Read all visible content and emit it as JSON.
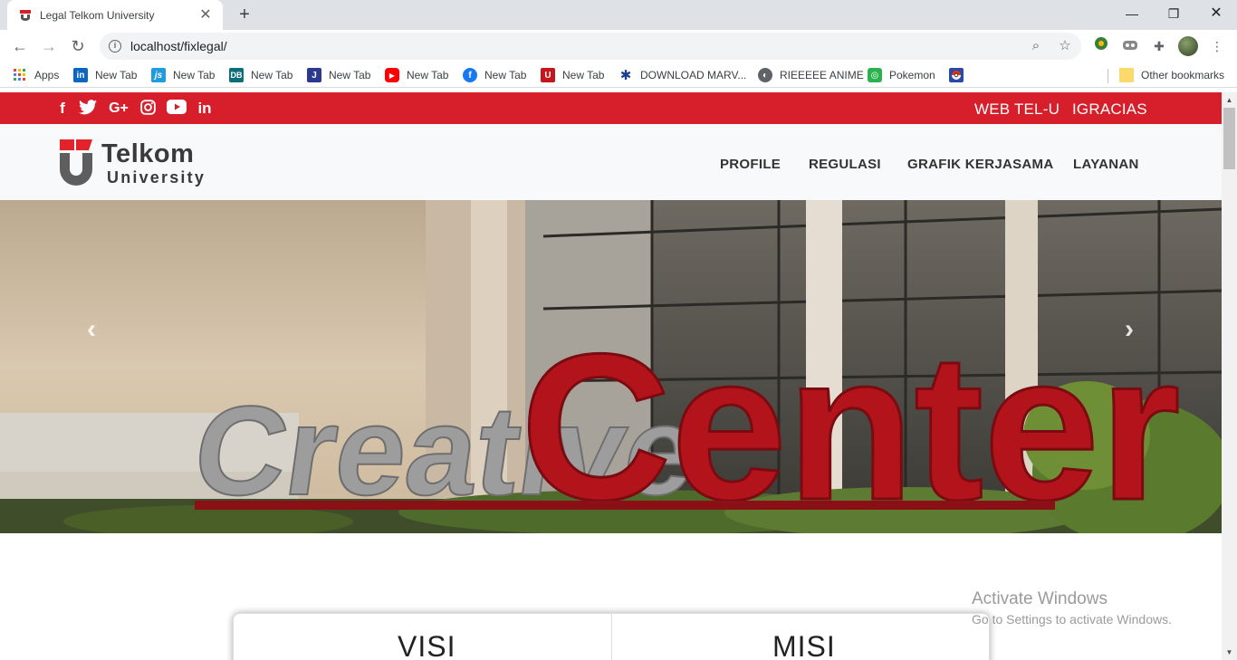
{
  "browser": {
    "tab_title": "Legal Telkom University",
    "url": "localhost/fixlegal/",
    "bookmarks": [
      {
        "label": "Apps",
        "icon": "apps-grid-icon"
      },
      {
        "label": "New Tab",
        "icon": "linkedin-icon"
      },
      {
        "label": "New Tab",
        "icon": "js-icon"
      },
      {
        "label": "New Tab",
        "icon": "dev-icon"
      },
      {
        "label": "New Tab",
        "icon": "jira-icon"
      },
      {
        "label": "New Tab",
        "icon": "youtube-icon"
      },
      {
        "label": "New Tab",
        "icon": "facebook-icon"
      },
      {
        "label": "New Tab",
        "icon": "telkom-icon"
      },
      {
        "label": "DOWNLOAD MARV...",
        "icon": "pinwheel-icon"
      },
      {
        "label": "RIEEEEE ANIME",
        "icon": "globe-icon"
      },
      {
        "label": "Pokemon",
        "icon": "pokemon-icon"
      },
      {
        "label": "",
        "icon": "pokeball-icon"
      }
    ],
    "other_bookmarks": "Other bookmarks"
  },
  "topbar": {
    "links": [
      "WEB TEL-U",
      "IGRACIAS"
    ],
    "social": [
      "facebook-icon",
      "twitter-icon",
      "google-plus-icon",
      "instagram-icon",
      "youtube-icon",
      "linkedin-icon"
    ]
  },
  "navbar": {
    "logo_line1": "Telkom",
    "logo_line2": "University",
    "menu": [
      "PROFILE",
      "REGULASI",
      "GRAFIK KERJASAMA",
      "LAYANAN"
    ]
  },
  "hero": {
    "sign_word1": "Creative",
    "sign_word2": "Center"
  },
  "cards": {
    "visi": "VISI",
    "misi": "MISI"
  },
  "watermark": {
    "line1": "Activate Windows",
    "line2": "Go to Settings to activate Windows."
  },
  "colors": {
    "brand_red": "#d71f2b",
    "nav_bg": "#f8f9fa"
  }
}
